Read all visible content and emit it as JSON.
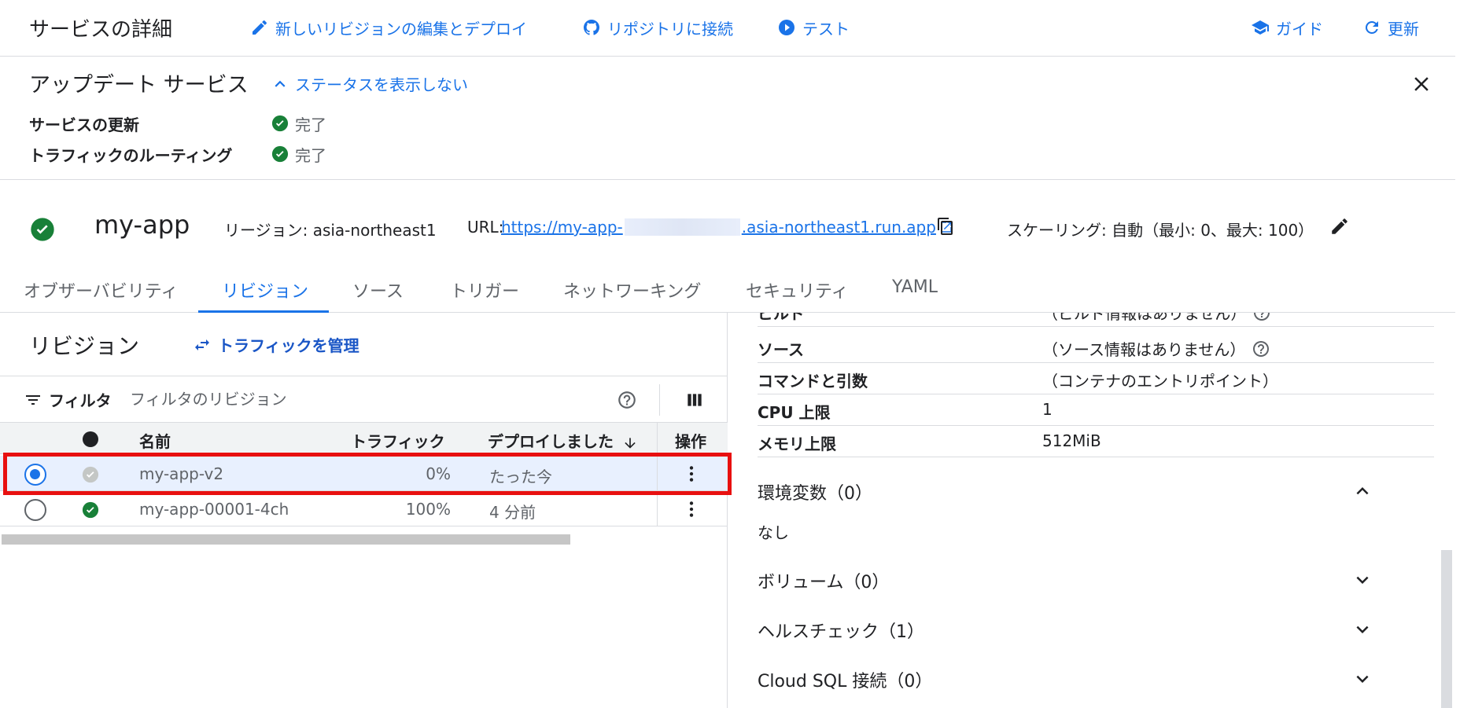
{
  "header": {
    "title": "サービスの詳細",
    "edit_deploy": "新しいリビジョンの編集とデプロイ",
    "connect_repo": "リポジトリに接続",
    "test": "テスト",
    "guide": "ガイド",
    "refresh": "更新"
  },
  "update_panel": {
    "title": "アップデート サービス",
    "toggle": "ステータスを表示しない",
    "rows": [
      {
        "label": "サービスの更新",
        "status": "完了"
      },
      {
        "label": "トラフィックのルーティング",
        "status": "完了"
      }
    ]
  },
  "service": {
    "name": "my-app",
    "region": "リージョン: asia-northeast1",
    "url_label": "URL:",
    "url_start": "https://my-app-",
    "url_end": ".asia-northeast1.run.app",
    "scaling": "スケーリング: 自動（最小: 0、最大: 100）"
  },
  "tabs": [
    "オブザーバビリティ",
    "リビジョン",
    "ソース",
    "トリガー",
    "ネットワーキング",
    "セキュリティ",
    "YAML"
  ],
  "revisions": {
    "title": "リビジョン",
    "manage_traffic": "トラフィックを管理",
    "filter_label": "フィルタ",
    "filter_placeholder": "フィルタのリビジョン",
    "columns": {
      "name": "名前",
      "traffic": "トラフィック",
      "deployed": "デプロイしました",
      "actions": "操作"
    },
    "rows": [
      {
        "name": "my-app-v2",
        "traffic": "0%",
        "deployed": "たった今",
        "selected": true,
        "status": "pending"
      },
      {
        "name": "my-app-00001-4ch",
        "traffic": "100%",
        "deployed": "4 分前",
        "selected": false,
        "status": "ok"
      }
    ]
  },
  "details": {
    "partial_top": {
      "key": "ビルド",
      "value": "（ビルド情報はありません）"
    },
    "rows": [
      {
        "key": "ソース",
        "value": "（ソース情報はありません）"
      },
      {
        "key": "コマンドと引数",
        "value": "（コンテナのエントリポイント）"
      },
      {
        "key": "CPU 上限",
        "value": "1"
      },
      {
        "key": "メモリ上限",
        "value": "512MiB"
      }
    ],
    "sections": [
      {
        "title": "環境変数（0）",
        "body": "なし",
        "expanded": true
      },
      {
        "title": "ボリューム（0）",
        "expanded": false
      },
      {
        "title": "ヘルスチェック（1）",
        "expanded": false
      },
      {
        "title": "Cloud SQL 接続（0）",
        "expanded": false
      }
    ]
  },
  "colors": {
    "accent": "#1a73e8",
    "success": "#188038",
    "highlight": "#e81010",
    "selected_row": "#e8f0fe"
  }
}
